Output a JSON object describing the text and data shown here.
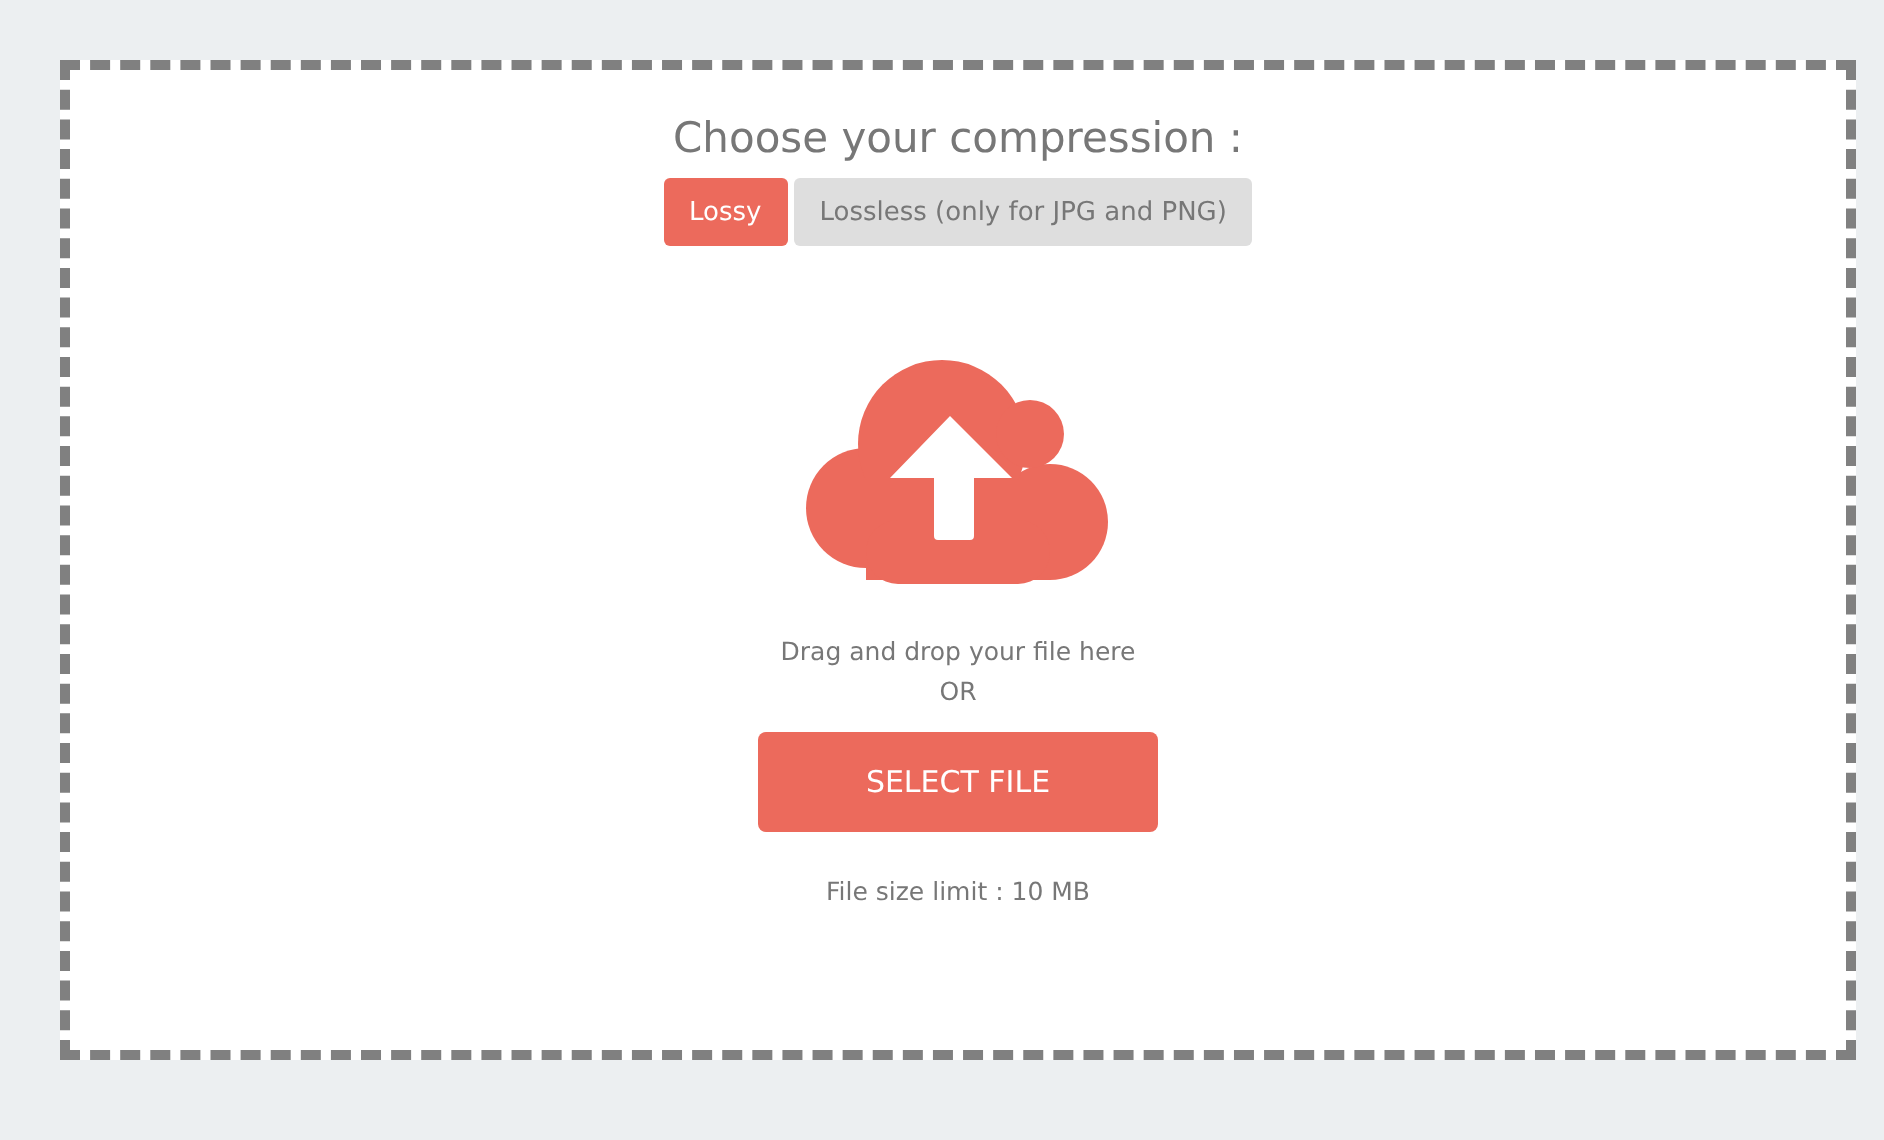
{
  "title": "Choose your compression :",
  "tabs": [
    {
      "label": "Lossy",
      "selected": true
    },
    {
      "label": "Lossless (only for JPG and PNG)",
      "selected": false
    }
  ],
  "drop_hint": "Drag and drop your file here",
  "or": "OR",
  "button": "SELECT FILE",
  "limit": "File size limit : 10 MB"
}
